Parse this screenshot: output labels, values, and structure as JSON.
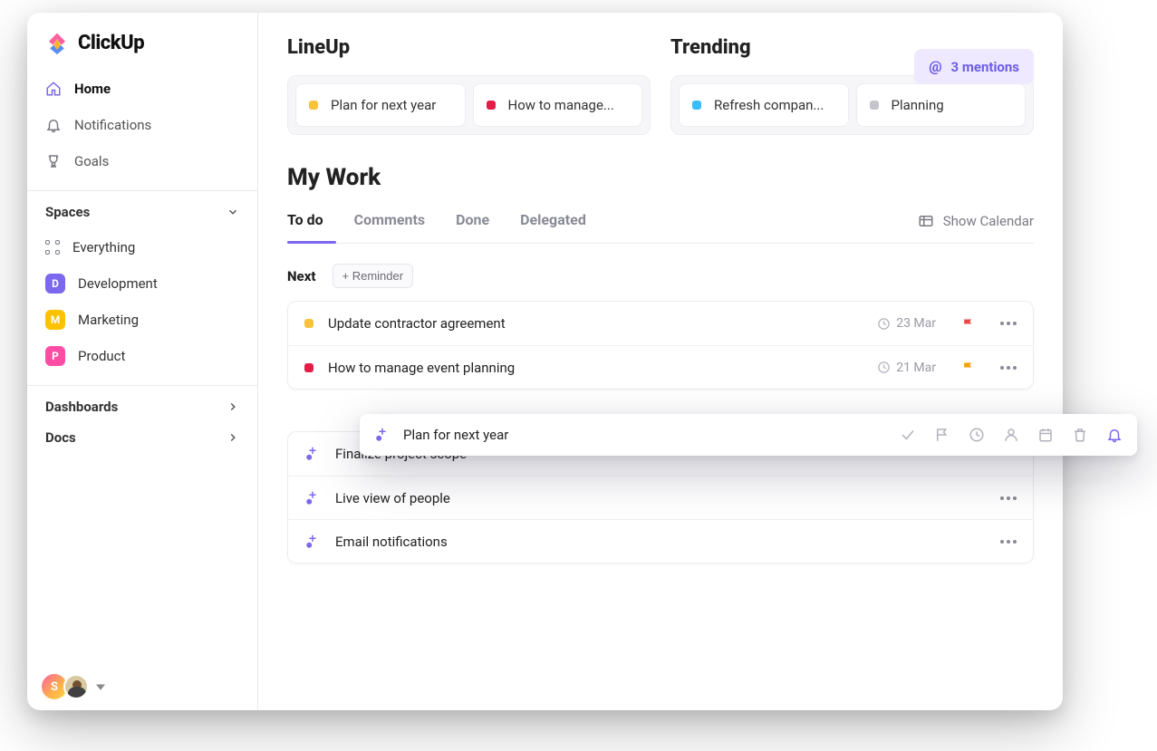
{
  "brand": {
    "name": "ClickUp"
  },
  "sidebar": {
    "nav": [
      {
        "label": "Home",
        "active": true
      },
      {
        "label": "Notifications",
        "active": false
      },
      {
        "label": "Goals",
        "active": false
      }
    ],
    "spaces_header": "Spaces",
    "spaces": [
      {
        "label": "Everything",
        "kind": "grid"
      },
      {
        "label": "Development",
        "kind": "badge",
        "badge_letter": "D",
        "badge_color": "#7b68ee"
      },
      {
        "label": "Marketing",
        "kind": "badge",
        "badge_letter": "M",
        "badge_color": "#fcc200"
      },
      {
        "label": "Product",
        "kind": "badge",
        "badge_letter": "P",
        "badge_color": "#ff4da6"
      }
    ],
    "sections": [
      {
        "label": "Dashboards"
      },
      {
        "label": "Docs"
      }
    ],
    "footer_avatar_letter": "S"
  },
  "mentions": {
    "label": "3 mentions"
  },
  "lineup": {
    "title": "LineUp",
    "cards": [
      {
        "label": "Plan for next year",
        "color": "#f9c23c"
      },
      {
        "label": "How to manage...",
        "color": "#e11d48"
      }
    ]
  },
  "trending": {
    "title": "Trending",
    "cards": [
      {
        "label": "Refresh compan...",
        "color": "#38bdf8"
      },
      {
        "label": "Planning",
        "color": "#c4c4cc"
      }
    ]
  },
  "mywork": {
    "title": "My Work",
    "tabs": [
      "To do",
      "Comments",
      "Done",
      "Delegated"
    ],
    "active_tab_index": 0,
    "show_calendar_label": "Show Calendar",
    "next_label": "Next",
    "reminder_button": "+ Reminder",
    "group1": [
      {
        "label": "Update contractor agreement",
        "color": "#f9c23c",
        "date": "23 Mar",
        "flag": "#ef4444"
      },
      {
        "label": "How to manage event planning",
        "color": "#e11d48",
        "date": "21 Mar",
        "flag": "#f59e0b"
      }
    ],
    "group2": [
      {
        "label": "Finalize project scope"
      },
      {
        "label": "Live view of people"
      },
      {
        "label": "Email notifications"
      }
    ]
  },
  "popover": {
    "title": "Plan for next year"
  }
}
